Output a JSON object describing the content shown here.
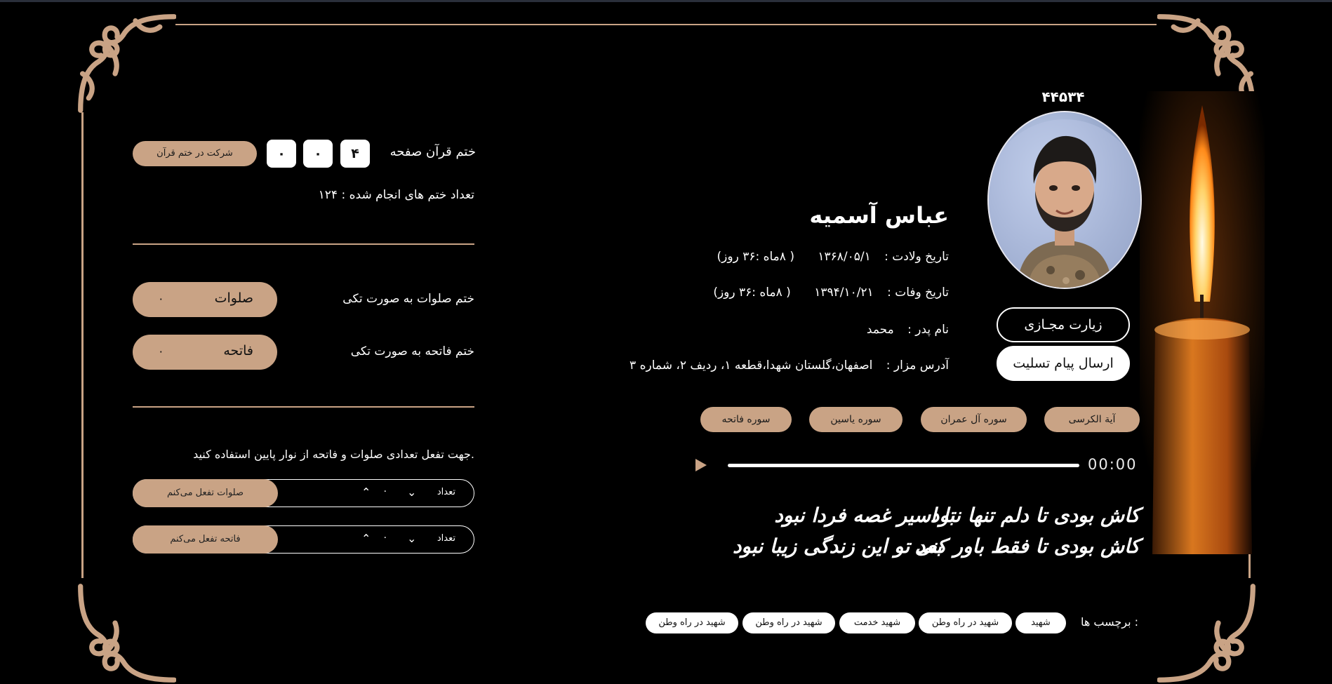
{
  "profile": {
    "visit_count": "۴۴۵۳۴",
    "name": "عباس آسمیه",
    "birth_label": "تاریخ ولادت :",
    "birth_date": "۱۳۶۸/۰۵/۱",
    "birth_extra": "( ۸ماه :۳۶ روز)",
    "death_label": "تاریخ وفات :",
    "death_date": "۱۳۹۴/۱۰/۲۱",
    "death_extra": "( ۸ماه :۳۶ روز)",
    "father_label": "نام پدر :",
    "father_name": "محمد",
    "address_label": "آدرس مزار :",
    "address": "اصفهان،گلستان شهدا،قطعه ۱، ردیف ۲، شماره ۳"
  },
  "actions": {
    "virtual_visit": "زیارت مجـازی",
    "condolence": "ارسال پیام تسلیت"
  },
  "surahs": [
    "آیة الکرسی",
    "سوره آل عمران",
    "سوره یاسین",
    "سوره فاتحه"
  ],
  "player": {
    "time": "00:00",
    "progress": 0
  },
  "poem": {
    "line1_right": "کاش بودی تا دلم تنها نبود",
    "line1_left": "تا اسیر غصه فردا نبود",
    "line2_right": "کاش بودی تا فقط باور کنی",
    "line2_left": "بعد تو این زندگی زیبا نبود"
  },
  "tags": {
    "label": "برچسب ها :",
    "items": [
      "شهید",
      "شهید در راه وطن",
      "شهید خدمت",
      "شهید در راه وطن",
      "شهید در راه وطن"
    ]
  },
  "quran": {
    "title": "ختم قرآن صفحه",
    "digits": [
      "۴",
      "۰",
      "۰"
    ],
    "join_button": "شرکت در ختم قرآن",
    "completed_label": "تعداد ختم های انجام شده :",
    "completed_count": "۱۲۴"
  },
  "salavat": {
    "label": "ختم صلوات به صورت تکی",
    "button_label": "صلوات",
    "count": "۰"
  },
  "fatiha": {
    "label": "ختم فاتحه به صورت تکی",
    "button_label": "فاتحه",
    "count": "۰"
  },
  "pledge": {
    "instruction": "جهت تفعل تعدادی صلوات و فاتحه از نوار پایین استفاده کنید.",
    "salavat_row": {
      "label": "تعداد",
      "value": "۰",
      "button": "صلوات تفعل می‌کنم"
    },
    "fatiha_row": {
      "label": "تعداد",
      "value": "۰",
      "button": "فاتحه تفعل می‌کنم"
    }
  },
  "colors": {
    "accent": "#c9a385",
    "background": "#000000",
    "text": "#ffffff"
  },
  "icons": [
    "ornament-corner-icon",
    "play-icon",
    "chevron-up-icon",
    "chevron-down-icon",
    "candle-image",
    "portrait-image"
  ]
}
